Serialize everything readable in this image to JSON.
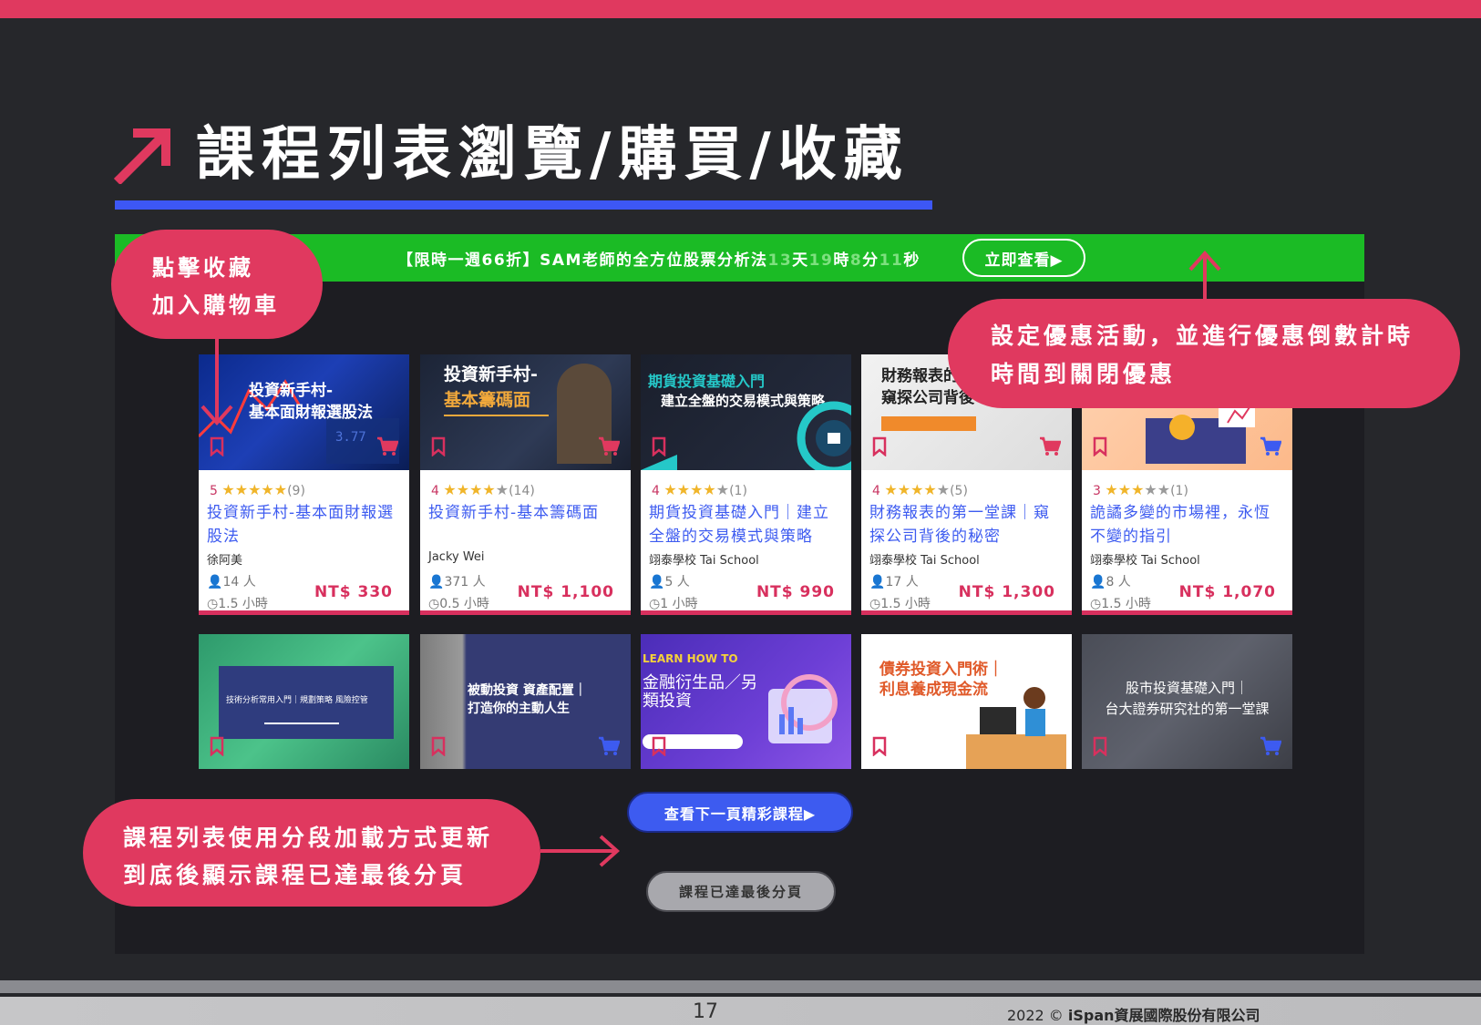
{
  "slide": {
    "title": "課程列表瀏覽/購買/收藏",
    "page_number": "17",
    "copyright_prefix": "2022 ©",
    "copyright_company": "iSpan資展國際股份有限公司"
  },
  "promo": {
    "text_prefix": "【限時一週66折】SAM老師的全方位股票分析法",
    "days_num": "13",
    "days_unit": "天",
    "hours_num": "19",
    "hours_unit": "時",
    "minutes_num": "8",
    "minutes_unit": "分",
    "seconds_num": "11",
    "seconds_unit": "秒",
    "button_label": "立即查看▶"
  },
  "courses": [
    {
      "thumb_title_1": "投資新手村-",
      "thumb_title_2": "基本面財報選股法",
      "rating": "5",
      "stars_on": 5,
      "reviews": "(9)",
      "title": "投資新手村-基本面財報選股法",
      "teacher": "徐阿美",
      "people": "14 人",
      "hours": "1.5 小時",
      "price": "NT$ 330"
    },
    {
      "thumb_title_1": "投資新手村-",
      "thumb_title_2": "基本籌碼面",
      "rating": "4",
      "stars_on": 4,
      "reviews": "(14)",
      "title": "投資新手村-基本籌碼面",
      "teacher": "Jacky Wei",
      "people": "371 人",
      "hours": "0.5 小時",
      "price": "NT$ 1,100"
    },
    {
      "thumb_title_1": "期貨投資基礎入門",
      "thumb_title_2": "建立全盤的交易模式與策略",
      "rating": "4",
      "stars_on": 4,
      "reviews": "(1)",
      "title": "期貨投資基礎入門｜建立全盤的交易模式與策略",
      "teacher": "翊泰學校 Tai School",
      "people": "5 人",
      "hours": "1 小時",
      "price": "NT$ 990"
    },
    {
      "thumb_title_1": "財務報表的",
      "thumb_title_2": "窺探公司背後",
      "rating": "4",
      "stars_on": 4,
      "reviews": "(5)",
      "title": "財務報表的第一堂課｜窺探公司背後的秘密",
      "teacher": "翊泰學校 Tai School",
      "people": "17 人",
      "hours": "1.5 小時",
      "price": "NT$ 1,300"
    },
    {
      "thumb_title_1": "",
      "thumb_title_2": "",
      "rating": "3",
      "stars_on": 3,
      "reviews": "(1)",
      "title": "詭譎多變的市場裡，永恆不變的指引",
      "teacher": "翊泰學校 Tai School",
      "people": "8 人",
      "hours": "1.5 小時",
      "price": "NT$ 1,070"
    }
  ],
  "courses_row2": [
    {
      "line1": "技術分析常用入門｜規劃策略 風險控管",
      "line2": ""
    },
    {
      "line1": "被動投資 資產配置｜",
      "line2": "打造你的主動人生"
    },
    {
      "line1": "LEARN HOW TO",
      "line2": "金融衍生品／另類投資"
    },
    {
      "line1": "債券投資入門術｜",
      "line2": "利息養成現金流"
    },
    {
      "line1": "股市投資基礎入門｜",
      "line2": "台大證券研究社的第一堂課"
    }
  ],
  "buttons": {
    "next_page": "查看下一頁精彩課程▶",
    "last_page": "課程已達最後分頁"
  },
  "callouts": {
    "favorite_line1": "點擊收藏",
    "favorite_line2": "加入購物車",
    "promo_line1": "設定優惠活動，並進行優惠倒數計時",
    "promo_line2": "時間到關閉優惠",
    "paging_line1": "課程列表使用分段加載方式更新",
    "paging_line2": "到底後顯示課程已達最後分頁"
  },
  "icons": {
    "title_arrow": "arrow-up-right-icon",
    "bookmark": "bookmark-icon",
    "cart": "cart-icon",
    "person": "person-icon",
    "clock": "clock-icon"
  },
  "colors": {
    "accent_pink": "#e0395f",
    "accent_blue": "#3d5bf0",
    "promo_green": "#1bbb25",
    "background": "#26272b"
  }
}
